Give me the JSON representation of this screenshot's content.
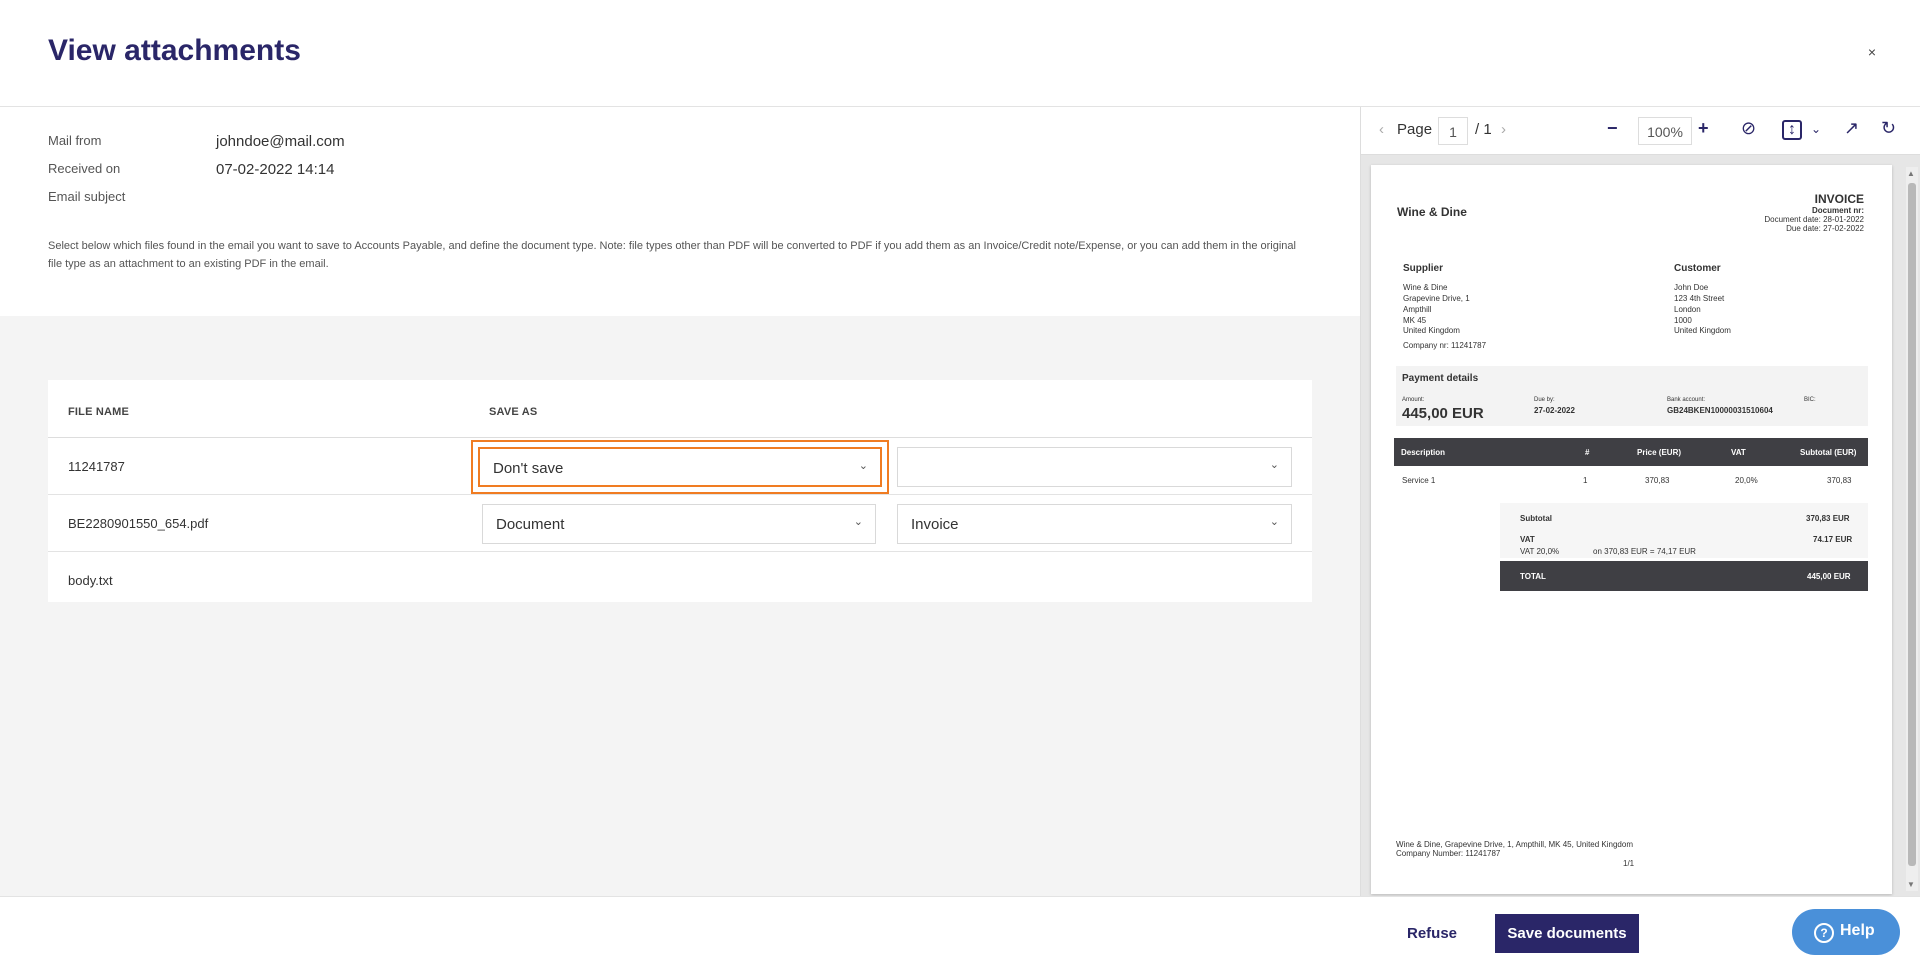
{
  "header": {
    "title": "View attachments",
    "close_label": "×"
  },
  "info": {
    "mail_from_label": "Mail from",
    "mail_from_value": "johndoe@mail.com",
    "received_label": "Received on",
    "received_value": "07-02-2022 14:14",
    "subject_label": "Email subject",
    "subject_value": "",
    "note": "Select below which files found in the email you want to save to Accounts Payable, and define the document type. Note: file types other than PDF will be converted to PDF if you add them as an Invoice/Credit note/Expense, or you can add them in the original file type as an attachment to an existing PDF in the email."
  },
  "table": {
    "col_file_name": "FILE NAME",
    "col_save_as": "SAVE AS",
    "rows": [
      {
        "name": "11241787",
        "save_as": "Don't save",
        "type": ""
      },
      {
        "name": "BE2280901550_654.pdf",
        "save_as": "Document",
        "type": "Invoice"
      },
      {
        "name": "body.txt"
      }
    ]
  },
  "viewer": {
    "page_label": "Page",
    "page_current": "1",
    "page_total": "/ 1",
    "zoom": "100%",
    "icons": [
      "chevron-left-icon",
      "chevron-right-icon",
      "zoom-out-icon",
      "zoom-in-icon",
      "hide-annotations-icon",
      "fit-page-icon",
      "open-external-icon",
      "rotate-icon"
    ]
  },
  "invoice": {
    "company": "Wine & Dine",
    "title": "INVOICE",
    "doc_nr": "Document nr:",
    "doc_date": "Document date: 28-01-2022",
    "due_date": "Due date: 27-02-2022",
    "supplier_label": "Supplier",
    "supplier_lines": [
      "Wine & Dine",
      "Grapevine Drive, 1",
      "Ampthill",
      "MK 45",
      "United Kingdom"
    ],
    "company_nr": "Company nr: 11241787",
    "customer_label": "Customer",
    "customer_lines": [
      "John Doe",
      "123 4th Street",
      "London",
      "1000",
      "United Kingdom"
    ],
    "payment_label": "Payment details",
    "amount_label": "Amount:",
    "amount_value": "445,00 EUR",
    "dueby_label": "Due by:",
    "dueby_value": "27-02-2022",
    "bank_label": "Bank account:",
    "bank_value": "GB24BKEN10000031510604",
    "bic_label": "BIC:",
    "lines_headers": [
      "Description",
      "#",
      "Price (EUR)",
      "VAT",
      "Subtotal (EUR)"
    ],
    "line_item": [
      "Service 1",
      "1",
      "370,83",
      "20,0%",
      "370,83"
    ],
    "subtotal_label": "Subtotal",
    "subtotal_value": "370,83 EUR",
    "vat_label": "VAT",
    "vat_value": "74.17 EUR",
    "vat_rate": "VAT 20,0%",
    "vat_detail": "on 370,83 EUR = 74,17 EUR",
    "total_label": "TOTAL",
    "total_value": "445,00 EUR",
    "footer_line1": "Wine & Dine, Grapevine Drive, 1,   Ampthill,  MK 45, United Kingdom",
    "footer_line2": "Company Number: 11241787",
    "page_num": "1/1"
  },
  "footer": {
    "refuse_label": "Refuse",
    "save_label": "Save documents",
    "help_label": "Help"
  }
}
